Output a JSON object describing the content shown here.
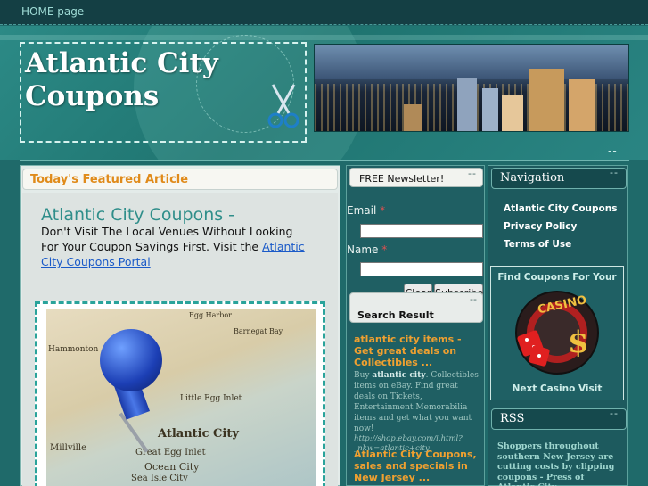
{
  "topbar": {
    "home_label": "HOME page"
  },
  "header": {
    "logo_line1": "Atlantic City",
    "logo_line2": "Coupons",
    "corner_dashes": "--"
  },
  "featured": {
    "heading": "Today's Featured Article",
    "title": "Atlantic City Coupons -",
    "text": "Don't Visit The Local Venues Without Looking For Your Coupon Savings First. Visit the ",
    "link_text": "Atlantic City Coupons Portal",
    "map_labels": [
      "Atlantic City",
      "Little Egg Inlet",
      "Great Egg Inlet",
      "Ocean City",
      "Sea Isle City",
      "Millville",
      "Hammonton",
      "Barnegat Bay",
      "Egg Harbor"
    ]
  },
  "newsletter": {
    "heading": "FREE Newsletter!",
    "dashes": "--",
    "email_label": "Email",
    "name_label": "Name",
    "required_mark": "*",
    "clear_label": "Clear",
    "subscribe_label": "Subscribe"
  },
  "search": {
    "heading": "Search Result",
    "dashes": "--",
    "results": [
      {
        "title": "atlantic city items - Get great deals on Collectibles ...",
        "desc_pre": "Buy ",
        "desc_bold": "atlantic city",
        "desc_post": ". Collectibles items on eBay. Find great deals on Tickets, Entertainment Memorabilia items and get what you want now!",
        "url": "http://shop.ebay.com/i.html?_nkw=atlantic+city"
      },
      {
        "title": "Atlantic City Coupons, sales and specials in New Jersey ..."
      }
    ]
  },
  "navigation": {
    "heading": "Navigation",
    "dashes": "--",
    "items": [
      "Atlantic City Coupons",
      "Privacy Policy",
      "Terms of Use"
    ]
  },
  "casino_promo": {
    "top_text": "Find Coupons For Your",
    "bottom_text": "Next Casino Visit",
    "logo_text": "CASINO",
    "logo_symbol": "$"
  },
  "rss": {
    "heading": "RSS",
    "dashes": "--",
    "text": "Shoppers throughout southern New Jersey are cutting costs by clipping coupons - Press of Atlantic City"
  }
}
